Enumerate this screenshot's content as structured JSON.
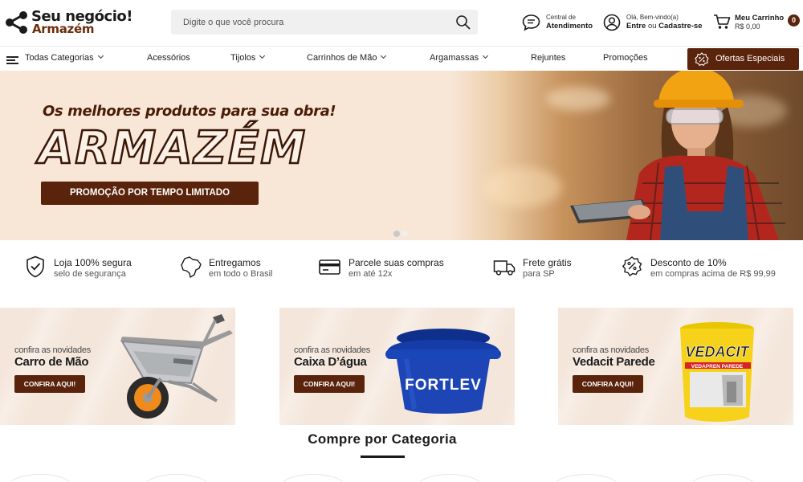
{
  "brand": {
    "line1": "Seu negócio!",
    "line2": "Armazém"
  },
  "search": {
    "placeholder": "Digite o que você procura"
  },
  "header": {
    "support": {
      "small": "Central de",
      "bold": "Atendimento"
    },
    "account": {
      "small": "Olá, Bem-vindo(a)",
      "login": "Entre",
      "or": "ou",
      "signup": "Cadastre-se"
    },
    "cart": {
      "label": "Meu Carrinho",
      "total": "R$ 0,00",
      "count": "0"
    }
  },
  "nav": {
    "items": [
      {
        "label": "Todas Categorias",
        "has_menu": true
      },
      {
        "label": "Acessórios",
        "has_menu": false
      },
      {
        "label": "Tijolos",
        "has_menu": true
      },
      {
        "label": "Carrinhos de Mão",
        "has_menu": true
      },
      {
        "label": "Argamassas",
        "has_menu": true
      },
      {
        "label": "Rejuntes",
        "has_menu": false
      },
      {
        "label": "Promoções",
        "has_menu": false
      }
    ],
    "offers": "Ofertas Especiais"
  },
  "hero": {
    "subtitle": "Os melhores produtos para sua obra!",
    "title": "ARMAZÉM",
    "cta": "PROMOÇÃO POR TEMPO LIMITADO",
    "slides": 2,
    "active_slide": 1
  },
  "features": [
    {
      "icon": "shield-check-icon",
      "title": "Loja 100% segura",
      "subtitle": "selo de segurança"
    },
    {
      "icon": "brazil-map-icon",
      "title": "Entregamos",
      "subtitle": "em todo o Brasil"
    },
    {
      "icon": "credit-card-icon",
      "title": "Parcele suas compras",
      "subtitle": "em até 12x"
    },
    {
      "icon": "truck-icon",
      "title": "Frete grátis",
      "subtitle": "para SP"
    },
    {
      "icon": "discount-badge-icon",
      "title": "Desconto de 10%",
      "subtitle": "em compras acima de R$ 99,99"
    }
  ],
  "promos": [
    {
      "small": "confira as novidades",
      "title": "Carro de Mão",
      "button": "CONFIRA AQUI!",
      "art": "wheelbarrow"
    },
    {
      "small": "confira as novidades",
      "title": "Caixa D’água",
      "button": "CONFIRA AQUI!",
      "art": "water-tank",
      "art_text": "FORTLEV"
    },
    {
      "small": "confira as novidades",
      "title": "Vedacit Parede",
      "button": "CONFIRA AQUI!",
      "art": "paint-bucket",
      "art_text": "VEDACIT",
      "art_text2": "VEDAPREN PAREDE"
    }
  ],
  "section": {
    "title": "Compre por Categoria"
  },
  "colors": {
    "brand_brown": "#5a230b",
    "hero_bg": "#f8e7d7",
    "card_bg": "#f4e6da"
  }
}
